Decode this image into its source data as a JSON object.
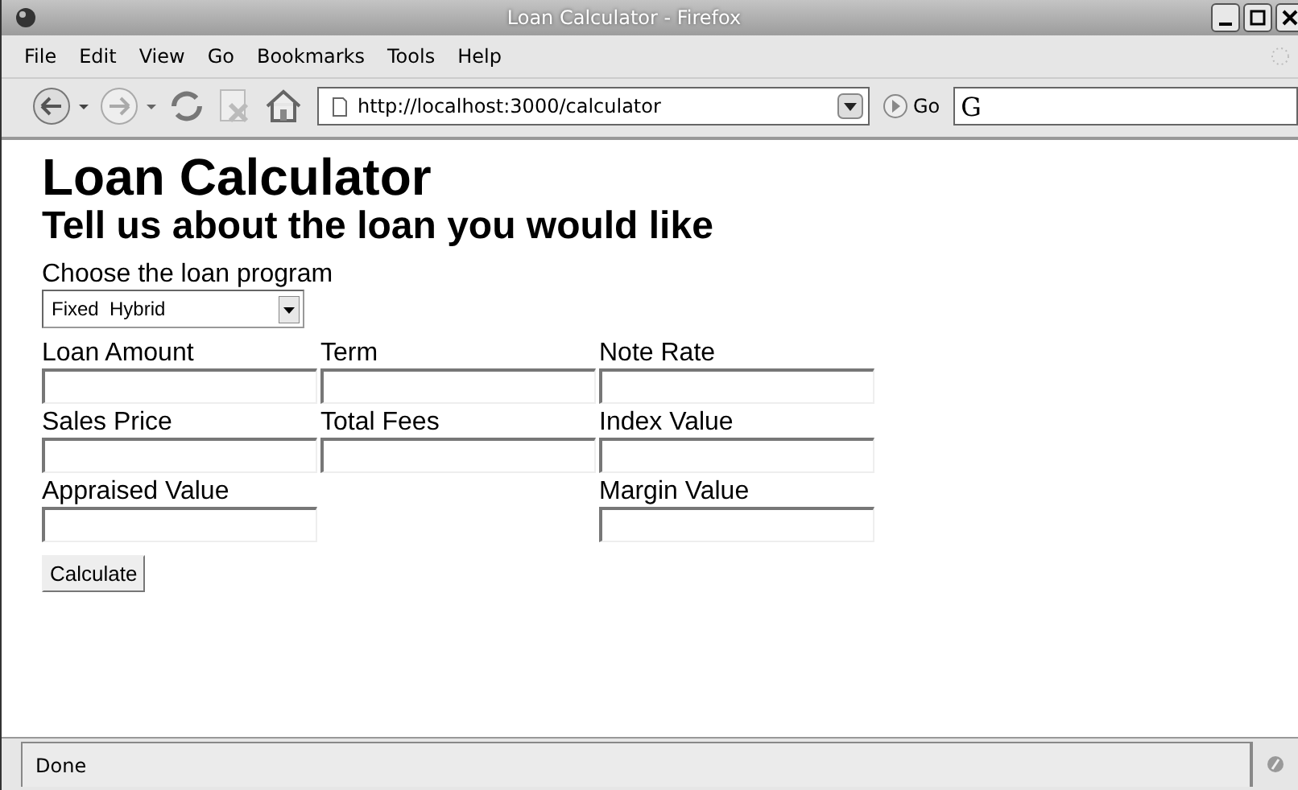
{
  "window": {
    "title": "Loan  Calculator - Firefox"
  },
  "menu": [
    "File",
    "Edit",
    "View",
    "Go",
    "Bookmarks",
    "Tools",
    "Help"
  ],
  "toolbar": {
    "address": "http://localhost:3000/calculator",
    "go_label": "Go",
    "search_mark": "G"
  },
  "page": {
    "title": "Loan Calculator",
    "subtitle": "Tell us about the loan you would like",
    "program_label": "Choose the loan program",
    "program_value": "Fixed  Hybrid",
    "rows": [
      {
        "left": {
          "label": "Loan Amount"
        },
        "middle": {
          "label": "Term"
        },
        "right": {
          "label": "Note Rate"
        }
      },
      {
        "left": {
          "label": "Sales Price"
        },
        "middle": {
          "label": "Total Fees"
        },
        "right": {
          "label": "Index Value"
        }
      },
      {
        "left": {
          "label": "Appraised Value"
        },
        "right": {
          "label": "Margin Value"
        }
      }
    ],
    "button": "Calculate"
  },
  "status_bar": {
    "text": "Done"
  }
}
